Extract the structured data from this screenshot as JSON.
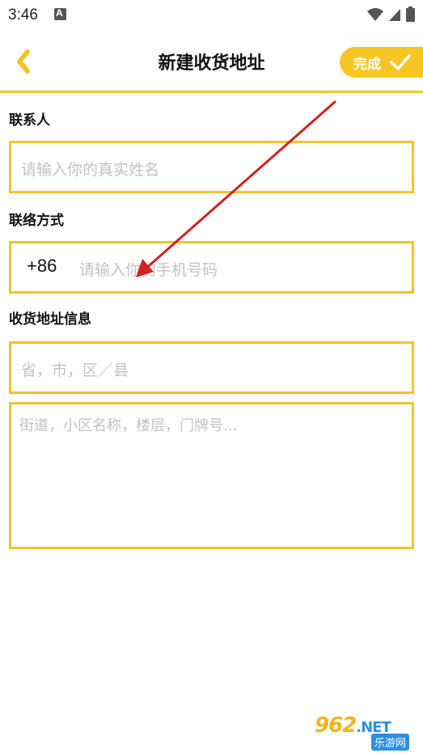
{
  "status_bar": {
    "time": "3:46",
    "icons": [
      "notification-a-icon",
      "wifi-icon",
      "signal-icon",
      "battery-icon"
    ]
  },
  "header": {
    "title": "新建收货地址",
    "done_label": "完成",
    "accent_color": "#f7c623"
  },
  "form": {
    "contact_label": "联系人",
    "name_placeholder": "请输入你的真实姓名",
    "phone_label": "联络方式",
    "phone_prefix": "+86",
    "phone_placeholder": "请输入你的手机号码",
    "address_label": "收货地址信息",
    "region_placeholder": "省，市，区／县",
    "street_placeholder": "街道，小区名称，楼层，门牌号..."
  },
  "watermark": {
    "logo": "962",
    "logo_suffix": ".NET",
    "sub": "乐游网"
  }
}
